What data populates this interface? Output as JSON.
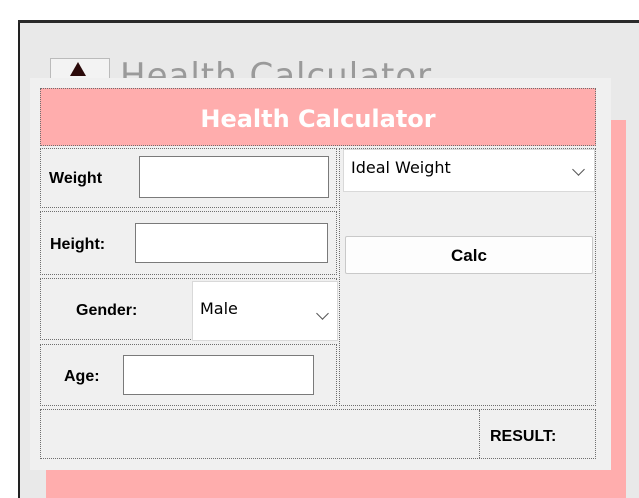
{
  "background_window": {
    "title": "Health Calculator"
  },
  "form": {
    "title": "Health Calculator",
    "weight": {
      "label": "Weight",
      "value": ""
    },
    "height": {
      "label": "Height:",
      "value": ""
    },
    "gender": {
      "label": "Gender:",
      "selected": "Male"
    },
    "age": {
      "label": "Age:",
      "value": ""
    },
    "calc_type": {
      "selected": "Ideal Weight"
    },
    "calc_button": "Calc",
    "result_label": "RESULT:"
  },
  "colors": {
    "header_bg": "#ffadad",
    "header_text": "#ffffff",
    "form_bg": "#f0f0f0"
  },
  "icons": [
    "chevron-down-icon",
    "app-icon"
  ]
}
